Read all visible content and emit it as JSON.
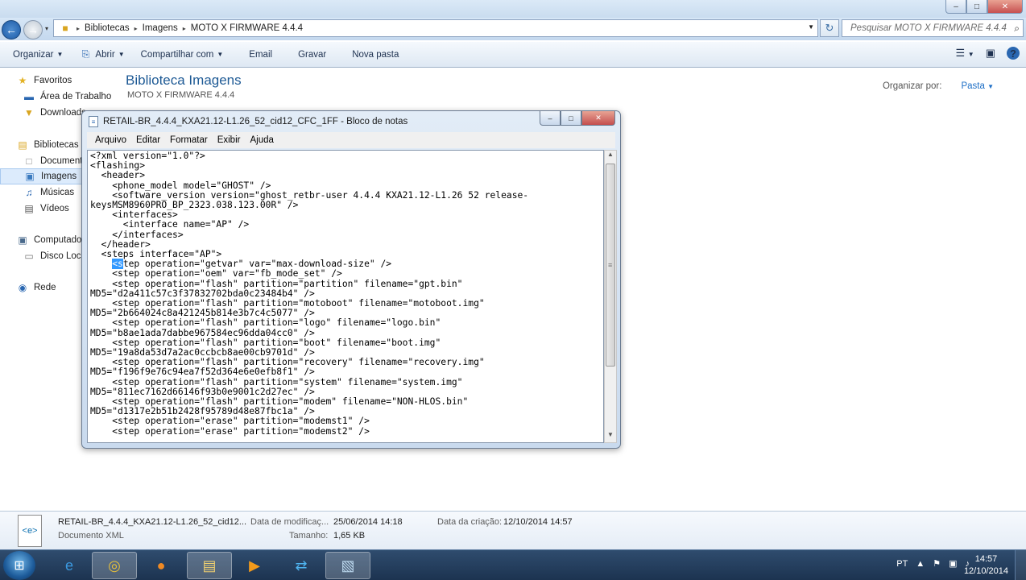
{
  "address": {
    "crumbs": [
      "Bibliotecas",
      "Imagens",
      "MOTO X FIRMWARE 4.4.4"
    ],
    "search_placeholder": "Pesquisar MOTO X FIRMWARE 4.4.4"
  },
  "toolbar": {
    "organize": "Organizar",
    "open": "Abrir",
    "share": "Compartilhar com",
    "email": "Email",
    "burn": "Gravar",
    "new_folder": "Nova pasta"
  },
  "nav": {
    "favorites": "Favoritos",
    "desktop": "Área de Trabalho",
    "downloads": "Downloads",
    "libraries": "Bibliotecas",
    "documents": "Documentos",
    "images": "Imagens",
    "music": "Músicas",
    "videos": "Vídeos",
    "computer": "Computador",
    "local_disk": "Disco Local",
    "network": "Rede"
  },
  "library": {
    "title": "Biblioteca Imagens",
    "subtitle": "MOTO X FIRMWARE 4.4.4",
    "arrange_label": "Organizar por:",
    "arrange_value": "Pasta"
  },
  "notepad": {
    "title": "RETAIL-BR_4.4.4_KXA21.12-L1.26_52_cid12_CFC_1FF - Bloco de notas",
    "menu": [
      "Arquivo",
      "Editar",
      "Formatar",
      "Exibir",
      "Ajuda"
    ],
    "text_before_selection": "<?xml version=\"1.0\"?>\n<flashing>\n  <header>\n    <phone_model model=\"GHOST\" />\n    <software_version version=\"ghost_retbr-user 4.4.4 KXA21.12-L1.26 52 release-\nkeysMSM8960PRO_BP_2323.038.123.00R\" />\n    <interfaces>\n      <interface name=\"AP\" />\n    </interfaces>\n  </header>\n  <steps interface=\"AP\">\n    ",
    "selected_text": "<s",
    "text_after_selection": "tep operation=\"getvar\" var=\"max-download-size\" />\n    <step operation=\"oem\" var=\"fb_mode_set\" />\n    <step operation=\"flash\" partition=\"partition\" filename=\"gpt.bin\"\nMD5=\"d2a411c57c3f37832702bda0c23484b4\" />\n    <step operation=\"flash\" partition=\"motoboot\" filename=\"motoboot.img\"\nMD5=\"2b664024c8a421245b814e3b7c4c5077\" />\n    <step operation=\"flash\" partition=\"logo\" filename=\"logo.bin\"\nMD5=\"b8ae1ada7dabbe967584ec96dda04cc0\" />\n    <step operation=\"flash\" partition=\"boot\" filename=\"boot.img\"\nMD5=\"19a8da53d7a2ac0ccbcb8ae00cb9701d\" />\n    <step operation=\"flash\" partition=\"recovery\" filename=\"recovery.img\"\nMD5=\"f196f9e76c94ea7f52d364e6e0efb8f1\" />\n    <step operation=\"flash\" partition=\"system\" filename=\"system.img\"\nMD5=\"811ec7162d66146f93b0e9001c2d27ec\" />\n    <step operation=\"flash\" partition=\"modem\" filename=\"NON-HLOS.bin\"\nMD5=\"d1317e2b51b2428f95789d48e87fbc1a\" />\n    <step operation=\"erase\" partition=\"modemst1\" />\n    <step operation=\"erase\" partition=\"modemst2\" />"
  },
  "details": {
    "filename": "RETAIL-BR_4.4.4_KXA21.12-L1.26_52_cid12...",
    "filetype": "Documento XML",
    "modified_label": "Data de modificaç...",
    "modified_value": "25/06/2014 14:18",
    "created_label": "Data da criação:",
    "created_value": "12/10/2014 14:57",
    "size_label": "Tamanho:",
    "size_value": "1,65 KB"
  },
  "taskbar": {
    "language": "PT",
    "time": "14:57",
    "date": "12/10/2014"
  }
}
